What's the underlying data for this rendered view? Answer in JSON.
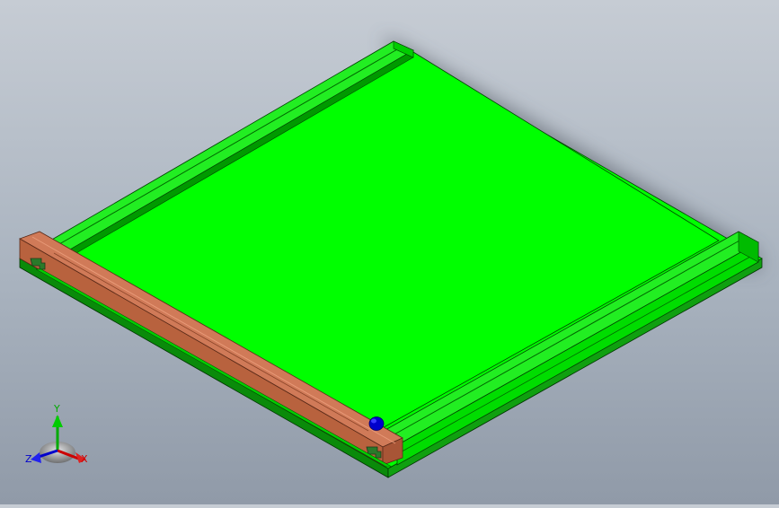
{
  "viewport": {
    "background_top": "#c6ccd4",
    "background_bottom": "#909aa8"
  },
  "model": {
    "plate_color": "#00ff00",
    "rail_color": "#00e000",
    "end_bar_color": "#c87050",
    "marker_color": "#0000cc"
  },
  "triad": {
    "x_label": "X",
    "y_label": "Y",
    "z_label": "Z",
    "x_color": "#cc0000",
    "y_color": "#00aa00",
    "z_color": "#0000cc"
  }
}
